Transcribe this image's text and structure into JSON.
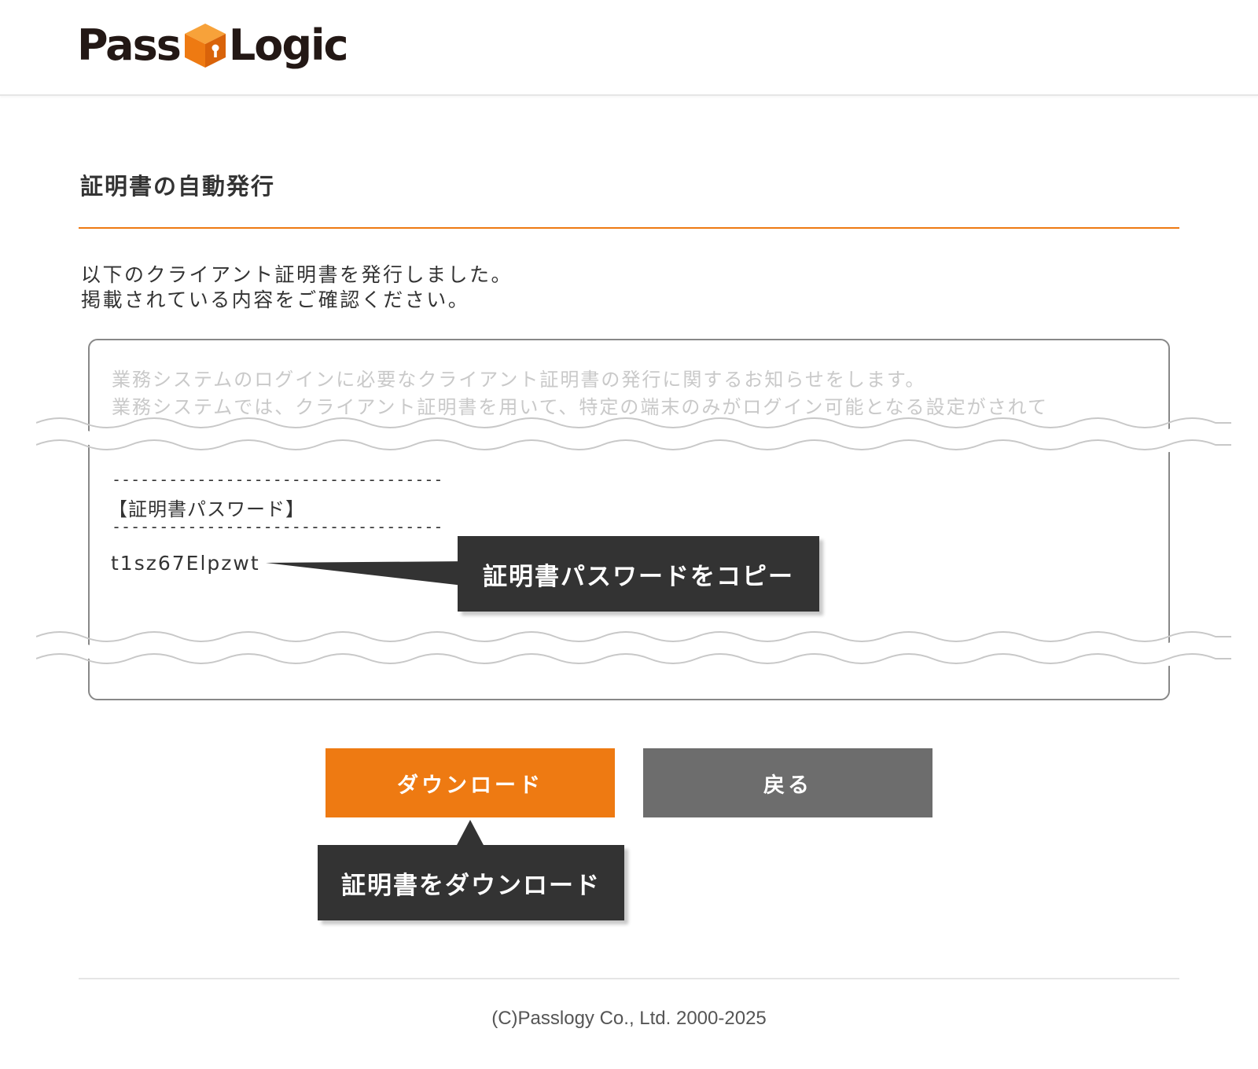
{
  "header": {
    "logo_left": "Pass",
    "logo_right": "Logic"
  },
  "page": {
    "title": "証明書の自動発行",
    "intro_line1": "以下のクライアント証明書を発行しました。",
    "intro_line2": "掲載されている内容をご確認ください。"
  },
  "mail": {
    "faded_line1": "業務システムのログインに必要なクライアント証明書の発行に関するお知らせをします。",
    "faded_line2": "業務システムでは、クライアント証明書を用いて、特定の端末のみがログイン可能となる設定がされて",
    "separator": "-----------------------------------",
    "password_label": "【証明書パスワード】",
    "password_value": "t1sz67Elpzwt"
  },
  "callouts": {
    "copy_password": "証明書パスワードをコピー",
    "download_certificate": "証明書をダウンロード"
  },
  "buttons": {
    "download": "ダウンロード",
    "back": "戻る"
  },
  "footer": {
    "copyright": "(C)Passlogy Co., Ltd. 2000-2025"
  },
  "colors": {
    "accent": "#ee7a12",
    "secondary_button": "#6d6d6d",
    "callout_bg": "#333333"
  }
}
